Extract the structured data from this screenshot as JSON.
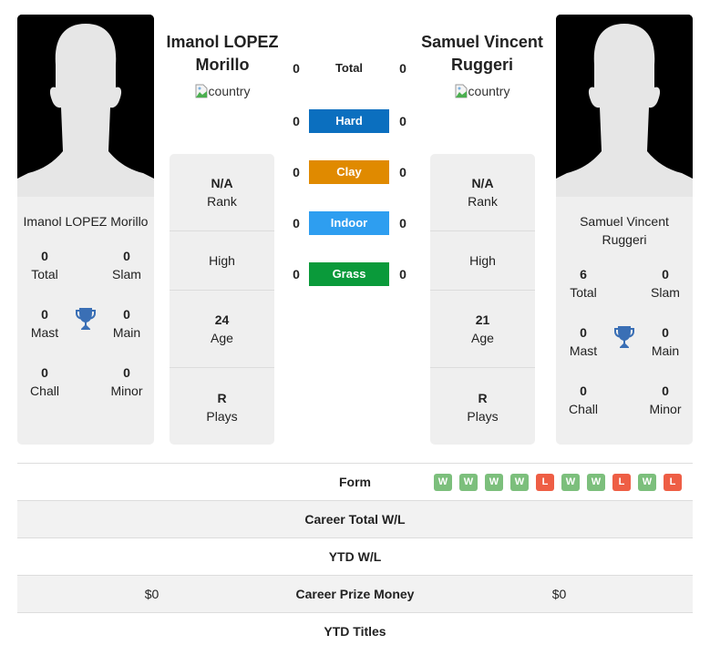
{
  "colors": {
    "hard": "#0b6fbf",
    "clay": "#e08a00",
    "indoor": "#2e9ef0",
    "grass": "#0a9a3a",
    "win": "#7cbf7c",
    "loss": "#ee5e45",
    "trophy": "#3a6fb5"
  },
  "player1": {
    "header_name": "Imanol LOPEZ Morillo",
    "card_name": "Imanol LOPEZ Morillo",
    "country_alt": "country",
    "photo_icon": "player-silhouette",
    "titles": {
      "total": {
        "value": "0",
        "label": "Total"
      },
      "slam": {
        "value": "0",
        "label": "Slam"
      },
      "mast": {
        "value": "0",
        "label": "Mast"
      },
      "main": {
        "value": "0",
        "label": "Main"
      },
      "chall": {
        "value": "0",
        "label": "Chall"
      },
      "minor": {
        "value": "0",
        "label": "Minor"
      }
    },
    "info": {
      "rank": {
        "value": "N/A",
        "label": "Rank"
      },
      "high": {
        "label": "High"
      },
      "age": {
        "value": "24",
        "label": "Age"
      },
      "plays": {
        "value": "R",
        "label": "Plays"
      }
    },
    "prize_money": "$0"
  },
  "player2": {
    "header_name": "Samuel Vincent Ruggeri",
    "card_name": "Samuel Vincent Ruggeri",
    "country_alt": "country",
    "photo_icon": "player-silhouette",
    "titles": {
      "total": {
        "value": "6",
        "label": "Total"
      },
      "slam": {
        "value": "0",
        "label": "Slam"
      },
      "mast": {
        "value": "0",
        "label": "Mast"
      },
      "main": {
        "value": "0",
        "label": "Main"
      },
      "chall": {
        "value": "0",
        "label": "Chall"
      },
      "minor": {
        "value": "0",
        "label": "Minor"
      }
    },
    "info": {
      "rank": {
        "value": "N/A",
        "label": "Rank"
      },
      "high": {
        "label": "High"
      },
      "age": {
        "value": "21",
        "label": "Age"
      },
      "plays": {
        "value": "R",
        "label": "Plays"
      }
    },
    "prize_money": "$0"
  },
  "h2h": [
    {
      "label": "Total",
      "p1": "0",
      "p2": "0"
    },
    {
      "label": "Hard",
      "p1": "0",
      "p2": "0"
    },
    {
      "label": "Clay",
      "p1": "0",
      "p2": "0"
    },
    {
      "label": "Indoor",
      "p1": "0",
      "p2": "0"
    },
    {
      "label": "Grass",
      "p1": "0",
      "p2": "0"
    }
  ],
  "table": {
    "form_label": "Form",
    "form": [
      "W",
      "W",
      "W",
      "W",
      "L",
      "W",
      "W",
      "L",
      "W",
      "L"
    ],
    "career_wl_label": "Career Total W/L",
    "ytd_wl_label": "YTD W/L",
    "prize_label": "Career Prize Money",
    "ytd_titles_label": "YTD Titles"
  }
}
